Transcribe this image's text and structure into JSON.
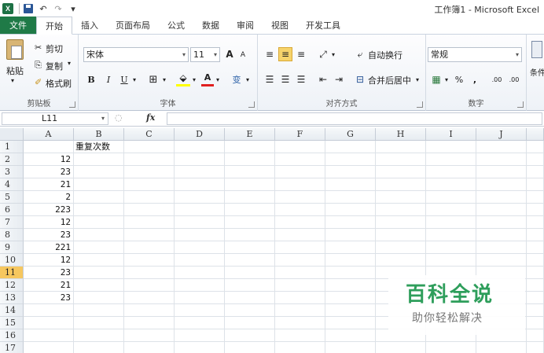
{
  "window": {
    "title": "工作簿1 - Microsoft Excel"
  },
  "qat": {
    "logo_letter": "X",
    "undo": "↶",
    "redo": "↷"
  },
  "tabs": [
    {
      "label": "文件"
    },
    {
      "label": "开始"
    },
    {
      "label": "插入"
    },
    {
      "label": "页面布局"
    },
    {
      "label": "公式"
    },
    {
      "label": "数据"
    },
    {
      "label": "审阅"
    },
    {
      "label": "视图"
    },
    {
      "label": "开发工具"
    }
  ],
  "ribbon": {
    "clipboard": {
      "label": "剪贴板",
      "paste": "粘贴",
      "cut": "剪切",
      "copy": "复制",
      "format_painter": "格式刷"
    },
    "font": {
      "label": "字体",
      "name": "宋体",
      "size": "11",
      "bold": "B",
      "italic": "I",
      "underline": "U",
      "grow": "A",
      "shrink": "A",
      "font_color": "A",
      "phonetic": "变"
    },
    "alignment": {
      "label": "对齐方式",
      "wrap": "自动换行",
      "merge": "合并后居中"
    },
    "number": {
      "label": "数字",
      "format": "常规",
      "percent": "%",
      "comma": ",",
      "inc_decimal": ".00",
      "dec_decimal": ".00"
    },
    "styles": {
      "conditional": "条件"
    }
  },
  "formula_bar": {
    "name_box": "L11",
    "fx": "fx",
    "value": ""
  },
  "sheet": {
    "columns": [
      "A",
      "B",
      "C",
      "D",
      "E",
      "F",
      "G",
      "H",
      "I",
      "J"
    ],
    "rows": [
      "1",
      "2",
      "3",
      "4",
      "5",
      "6",
      "7",
      "8",
      "9",
      "10",
      "11",
      "12",
      "13",
      "14",
      "15",
      "16",
      "17"
    ],
    "selected_row": "11",
    "b1": "重复次数",
    "col_a": [
      "",
      "12",
      "23",
      "21",
      "2",
      "223",
      "12",
      "23",
      "221",
      "12",
      "23",
      "21",
      "23",
      "",
      "",
      "",
      ""
    ]
  },
  "watermark": {
    "main": "百科全说",
    "sub": "助你轻松解决"
  },
  "colors": {
    "file_tab": "#1f7a47",
    "selected_row": "#f6c75f",
    "watermark": "#2e9e5b"
  }
}
